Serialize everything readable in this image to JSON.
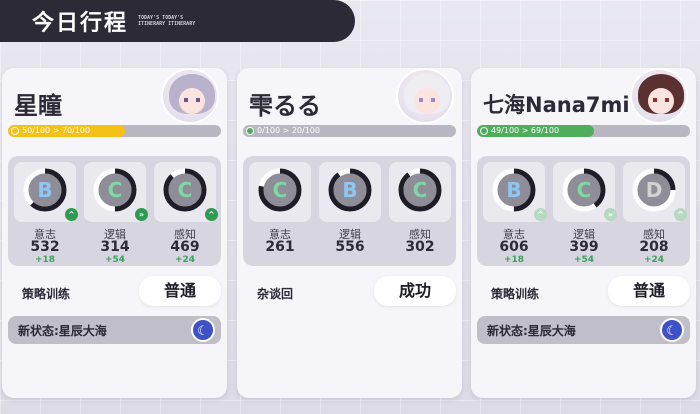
{
  "header": {
    "title": "今日行程",
    "subtitle": "TODAY'S TODAY'S ITINERARY ITINERARY"
  },
  "cards": [
    {
      "name": "星瞳",
      "progress_text": "50/100  >  70/100",
      "progress_fraction": 0.55,
      "progress_color": "#f5c116",
      "stats": [
        {
          "label": "意志",
          "value": "532",
          "delta": "+18",
          "grade": "B",
          "grade_color": "#8fc7f2",
          "ring_fraction": 0.62,
          "arrow": "^",
          "arrow_muted": false
        },
        {
          "label": "逻辑",
          "value": "314",
          "delta": "+54",
          "grade": "C",
          "grade_color": "#7fd8a3",
          "ring_fraction": 0.5,
          "arrow": "»",
          "arrow_muted": false
        },
        {
          "label": "感知",
          "value": "469",
          "delta": "+24",
          "grade": "C",
          "grade_color": "#7fd8a3",
          "ring_fraction": 0.88,
          "arrow": "^",
          "arrow_muted": false
        }
      ],
      "action_label": "策略训练",
      "action_button": "普通",
      "status_text": "新状态:星辰大海",
      "status_icon": "moon-wave-icon"
    },
    {
      "name": "雫るる",
      "progress_text": "0/100  >  20/100",
      "progress_fraction": 0.0,
      "progress_color": "#4fae5c",
      "stats": [
        {
          "label": "意志",
          "value": "261",
          "delta": "",
          "grade": "C",
          "grade_color": "#7fd8a3",
          "ring_fraction": 0.78,
          "arrow": "",
          "arrow_muted": false
        },
        {
          "label": "逻辑",
          "value": "556",
          "delta": "",
          "grade": "B",
          "grade_color": "#8fc7f2",
          "ring_fraction": 0.9,
          "arrow": "",
          "arrow_muted": false
        },
        {
          "label": "感知",
          "value": "302",
          "delta": "",
          "grade": "C",
          "grade_color": "#7fd8a3",
          "ring_fraction": 0.9,
          "arrow": "",
          "arrow_muted": false
        }
      ],
      "action_label": "杂谈回",
      "action_button": "成功",
      "status_text": "",
      "status_icon": ""
    },
    {
      "name": "七海Nana7mi",
      "progress_text": "49/100  >  69/100",
      "progress_fraction": 0.55,
      "progress_color": "#4fae5c",
      "stats": [
        {
          "label": "意志",
          "value": "606",
          "delta": "+18",
          "grade": "B",
          "grade_color": "#8fc7f2",
          "ring_fraction": 0.5,
          "arrow": "^",
          "arrow_muted": true
        },
        {
          "label": "逻辑",
          "value": "399",
          "delta": "+54",
          "grade": "C",
          "grade_color": "#7fd8a3",
          "ring_fraction": 0.4,
          "arrow": "»",
          "arrow_muted": true
        },
        {
          "label": "感知",
          "value": "208",
          "delta": "+24",
          "grade": "D",
          "grade_color": "#d2d2d6",
          "ring_fraction": 0.25,
          "arrow": "^",
          "arrow_muted": true
        }
      ],
      "action_label": "策略训练",
      "action_button": "普通",
      "status_text": "新状态:星辰大海",
      "status_icon": "moon-wave-icon"
    }
  ]
}
